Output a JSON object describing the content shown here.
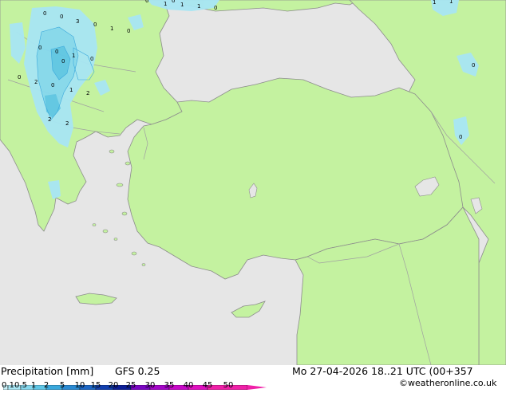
{
  "footer": {
    "title": "Precipitation [mm]",
    "model": "GFS 0.25",
    "datetime": "Mo 27-04-2026 18..21 UTC (00+357",
    "credit": "©weatheronline.co.uk"
  },
  "legend": {
    "ticks": [
      "0.1",
      "0.5",
      "1",
      "2",
      "5",
      "10",
      "15",
      "20",
      "25",
      "30",
      "35",
      "40",
      "45",
      "50"
    ],
    "colors": [
      "#c8f0f8",
      "#a8e6f4",
      "#86d8ee",
      "#5fc6e6",
      "#3aa8dc",
      "#2a8ad2",
      "#1c66c4",
      "#1240ae",
      "#0c1e96",
      "#7a06c2",
      "#a406c8",
      "#c808c8",
      "#e010c0",
      "#f020a8"
    ]
  },
  "map": {
    "colors": {
      "sea": "#e6e6e6",
      "land": "#c4f2a0",
      "border": "#a0a0a0",
      "coast": "#8c8c8c"
    },
    "labels": [
      "0",
      "0",
      "1",
      "1",
      "1",
      "1",
      "0",
      "0",
      "3",
      "0",
      "1",
      "0",
      "0",
      "0",
      "1",
      "0",
      "0",
      "2",
      "0",
      "1",
      "2",
      "2",
      "2",
      "0",
      "1",
      "0",
      "0",
      "0"
    ]
  }
}
